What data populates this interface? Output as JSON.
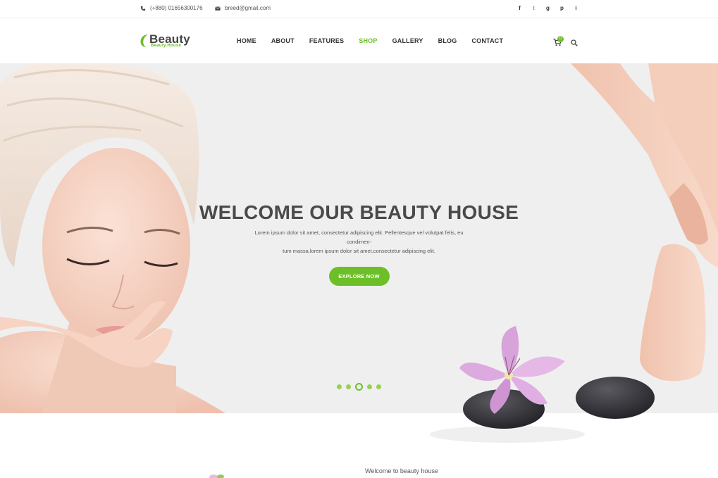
{
  "topbar": {
    "phone": "(+880) 01656300176",
    "email": "breed@gmail.com",
    "social": [
      "f",
      "t",
      "g",
      "p",
      "i"
    ]
  },
  "header": {
    "logo_name": "Beauty",
    "logo_sub": "Beauty.House",
    "nav": [
      {
        "label": "HOME"
      },
      {
        "label": "ABOUT"
      },
      {
        "label": "FEATURES"
      },
      {
        "label": "SHOP"
      },
      {
        "label": "GALLERY"
      },
      {
        "label": "BLOG"
      },
      {
        "label": "CONTACT"
      }
    ],
    "cart_count": "0"
  },
  "hero": {
    "title": "WELCOME OUR BEAUTY HOUSE",
    "text_line1": "Lorem ipsum dolor sit amet, consectetur adipiscing elit. Pellentesque vel volutpat felis, eu condimen-",
    "text_line2": "tum massa.lorem ipsum dolor sit amet,consectetur adipiscing elit.",
    "button": "EXPLORE NOW",
    "active_slide": 3,
    "slide_count": 5
  },
  "section": {
    "welcome": "Welcome to beauty house"
  },
  "colors": {
    "accent": "#6cbf26",
    "hero_bg": "#efefef"
  }
}
